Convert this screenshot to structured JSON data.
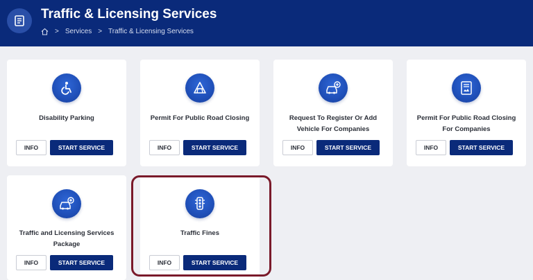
{
  "header": {
    "title": "Traffic & Licensing Services",
    "icon": "document-icon",
    "breadcrumb": {
      "home_icon": "home-icon",
      "items": [
        "Services",
        "Traffic & Licensing Services"
      ],
      "separator": ">"
    },
    "background": "#0a2a7a"
  },
  "cards": [
    {
      "label": "Disability Parking",
      "icon": "wheelchair-icon",
      "info_label": "INFO",
      "start_label": "START SERVICE"
    },
    {
      "label": "Permit For Public Road Closing",
      "icon": "road-closure-icon",
      "info_label": "INFO",
      "start_label": "START SERVICE"
    },
    {
      "label": "Request To Register Or Add Vehicle For Companies",
      "icon": "add-vehicle-icon",
      "info_label": "INFO",
      "start_label": "START SERVICE"
    },
    {
      "label": "Permit For Public Road Closing For Companies",
      "icon": "permit-document-icon",
      "info_label": "INFO",
      "start_label": "START SERVICE"
    },
    {
      "label": "Traffic and Licensing Services Package",
      "icon": "vehicle-package-icon",
      "info_label": "INFO",
      "start_label": "START SERVICE"
    },
    {
      "label": "Traffic Fines",
      "icon": "traffic-light-icon",
      "info_label": "INFO",
      "start_label": "START SERVICE",
      "highlighted": true
    }
  ],
  "colors": {
    "primary": "#0a2a7a",
    "icon_blue": "#1f4fb8",
    "highlight_border": "#7a1a2a",
    "page_bg": "#eeeff3"
  }
}
